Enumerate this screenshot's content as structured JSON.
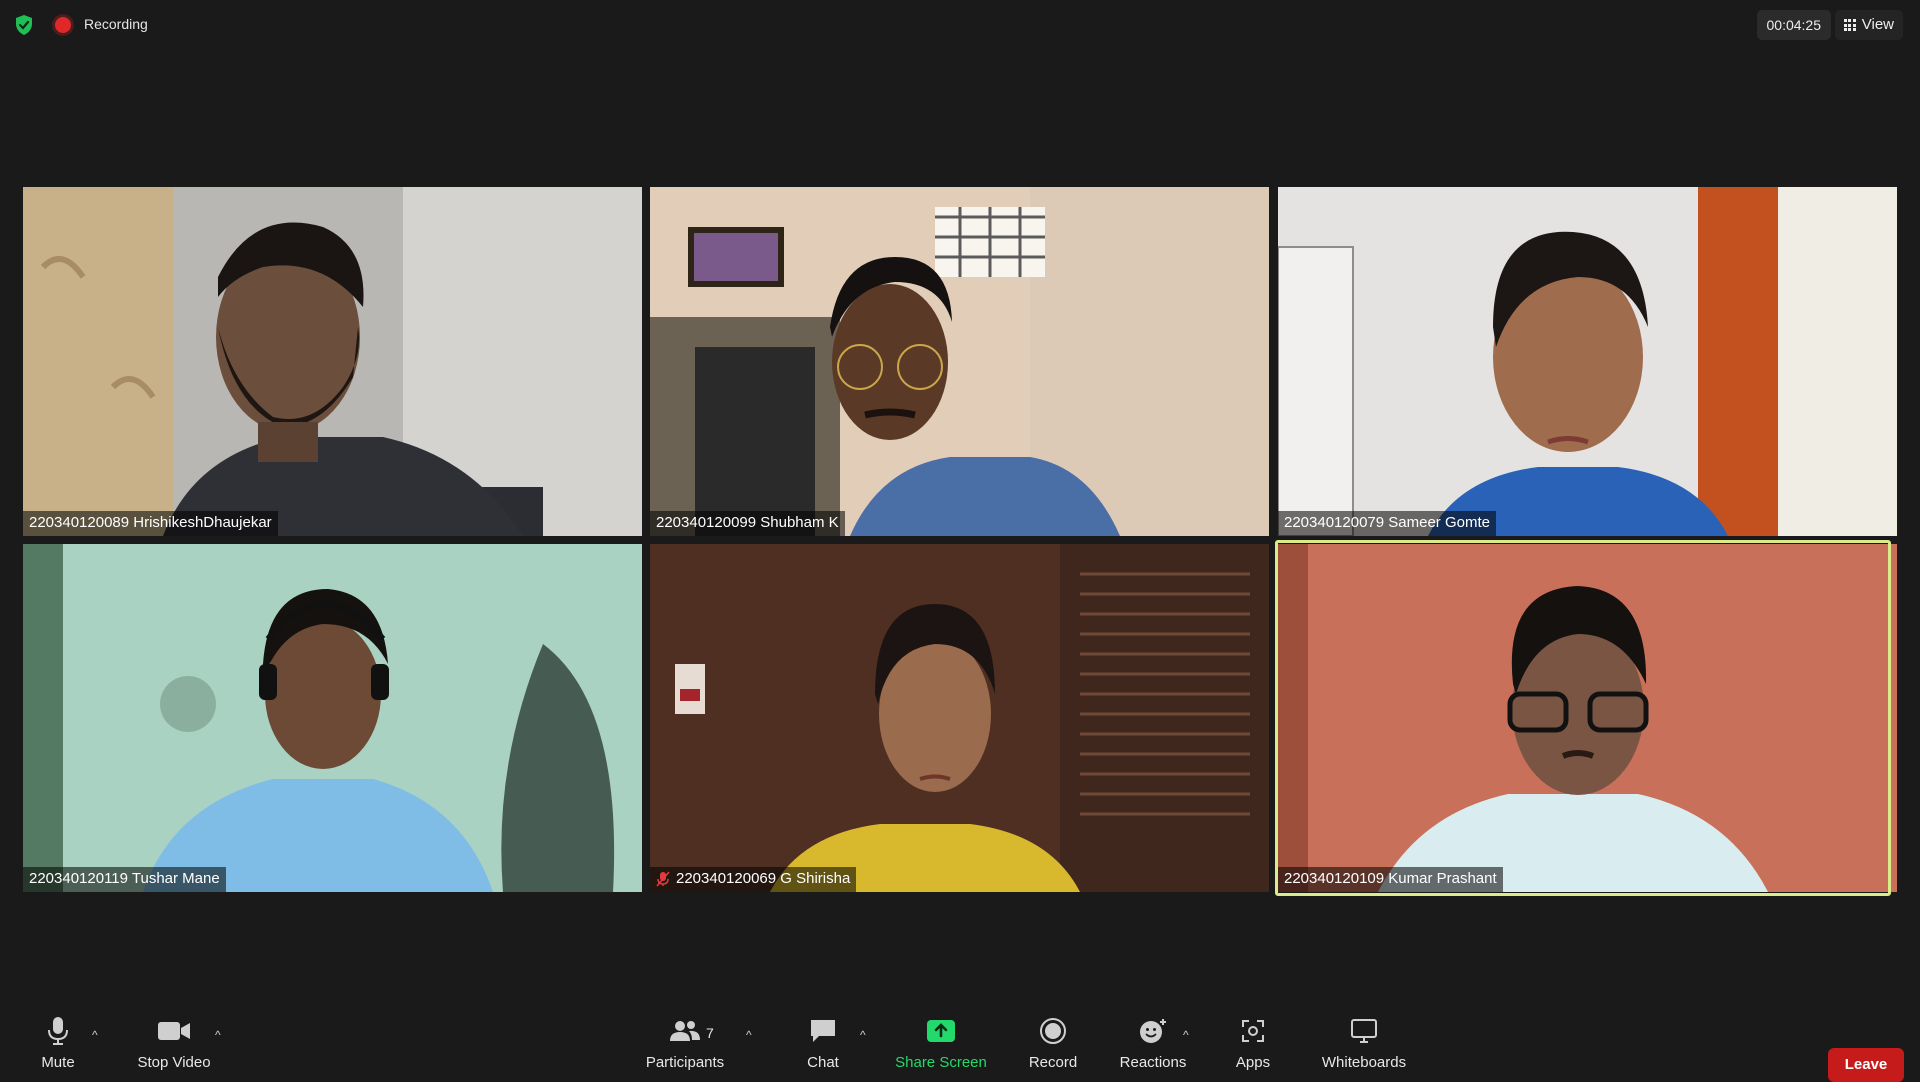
{
  "top_bar": {
    "recording_label": "Recording",
    "timer": "00:04:25",
    "view_label": "View"
  },
  "participants": [
    {
      "name": "220340120089 HrishikeshDhaujekar",
      "muted": false,
      "active_speaker": false
    },
    {
      "name": "220340120099 Shubham K",
      "muted": false,
      "active_speaker": false
    },
    {
      "name": "220340120079 Sameer Gomte",
      "muted": false,
      "active_speaker": false
    },
    {
      "name": "220340120119 Tushar Mane",
      "muted": false,
      "active_speaker": false
    },
    {
      "name": "220340120069 G Shirisha",
      "muted": true,
      "active_speaker": false
    },
    {
      "name": "220340120109 Kumar Prashant",
      "muted": false,
      "active_speaker": true
    }
  ],
  "toolbar": {
    "mute_label": "Mute",
    "stop_video_label": "Stop Video",
    "participants_label": "Participants",
    "participants_count": "7",
    "chat_label": "Chat",
    "share_screen_label": "Share Screen",
    "record_label": "Record",
    "reactions_label": "Reactions",
    "apps_label": "Apps",
    "whiteboards_label": "Whiteboards",
    "leave_label": "Leave"
  },
  "colors": {
    "background": "#1a1a1a",
    "share_green": "#23d96b",
    "leave_red": "#c61b1b",
    "active_speaker_border": "#dceb8a",
    "recording_red": "#e02828"
  }
}
